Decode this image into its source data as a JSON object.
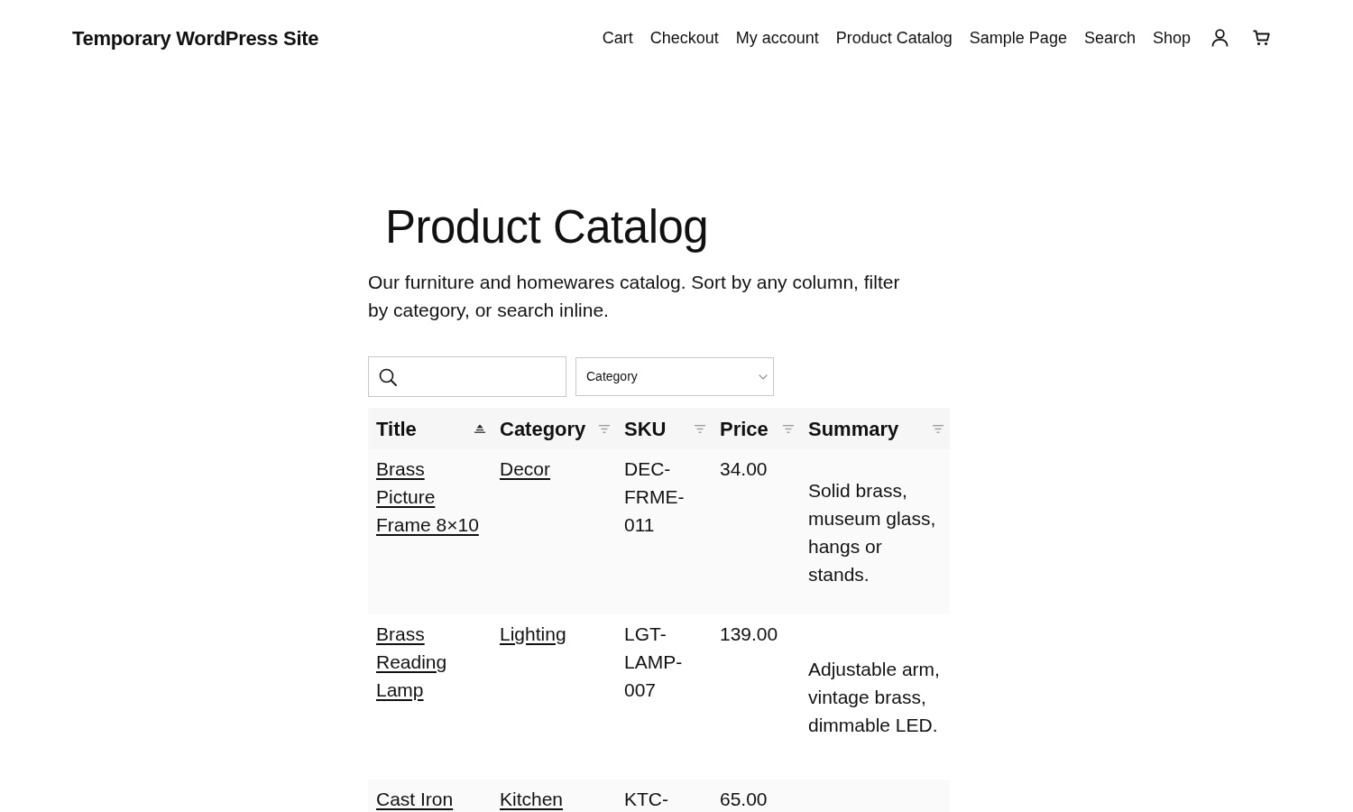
{
  "header": {
    "site_title": "Temporary WordPress Site",
    "nav_links": [
      "Cart",
      "Checkout",
      "My account",
      "Product Catalog",
      "Sample Page",
      "Search",
      "Shop"
    ]
  },
  "page": {
    "title": "Product Catalog",
    "description": "Our furniture and homewares catalog. Sort by any column, filter by category, or search inline."
  },
  "filters": {
    "category_select": {
      "value": "Category"
    }
  },
  "table": {
    "columns": [
      {
        "label": "Title",
        "sorted": true
      },
      {
        "label": "Category",
        "sorted": false
      },
      {
        "label": "SKU",
        "sorted": false
      },
      {
        "label": "Price",
        "sorted": false
      },
      {
        "label": "Summary",
        "sorted": false
      }
    ],
    "rows": [
      {
        "title": "Brass Picture Frame 8×10",
        "category": "Decor",
        "sku": "DEC-FRME-011",
        "price": "34.00",
        "summary": "Solid brass, museum glass, hangs or stands."
      },
      {
        "title": "Brass Reading Lamp",
        "category": "Lighting",
        "sku": "LGT-LAMP-007",
        "price": "139.00",
        "summary": "Adjustable arm, vintage brass, dimmable LED."
      },
      {
        "title": "Cast Iron",
        "category": "Kitchen",
        "sku": "KTC-",
        "price": "65.00"
      }
    ]
  }
}
